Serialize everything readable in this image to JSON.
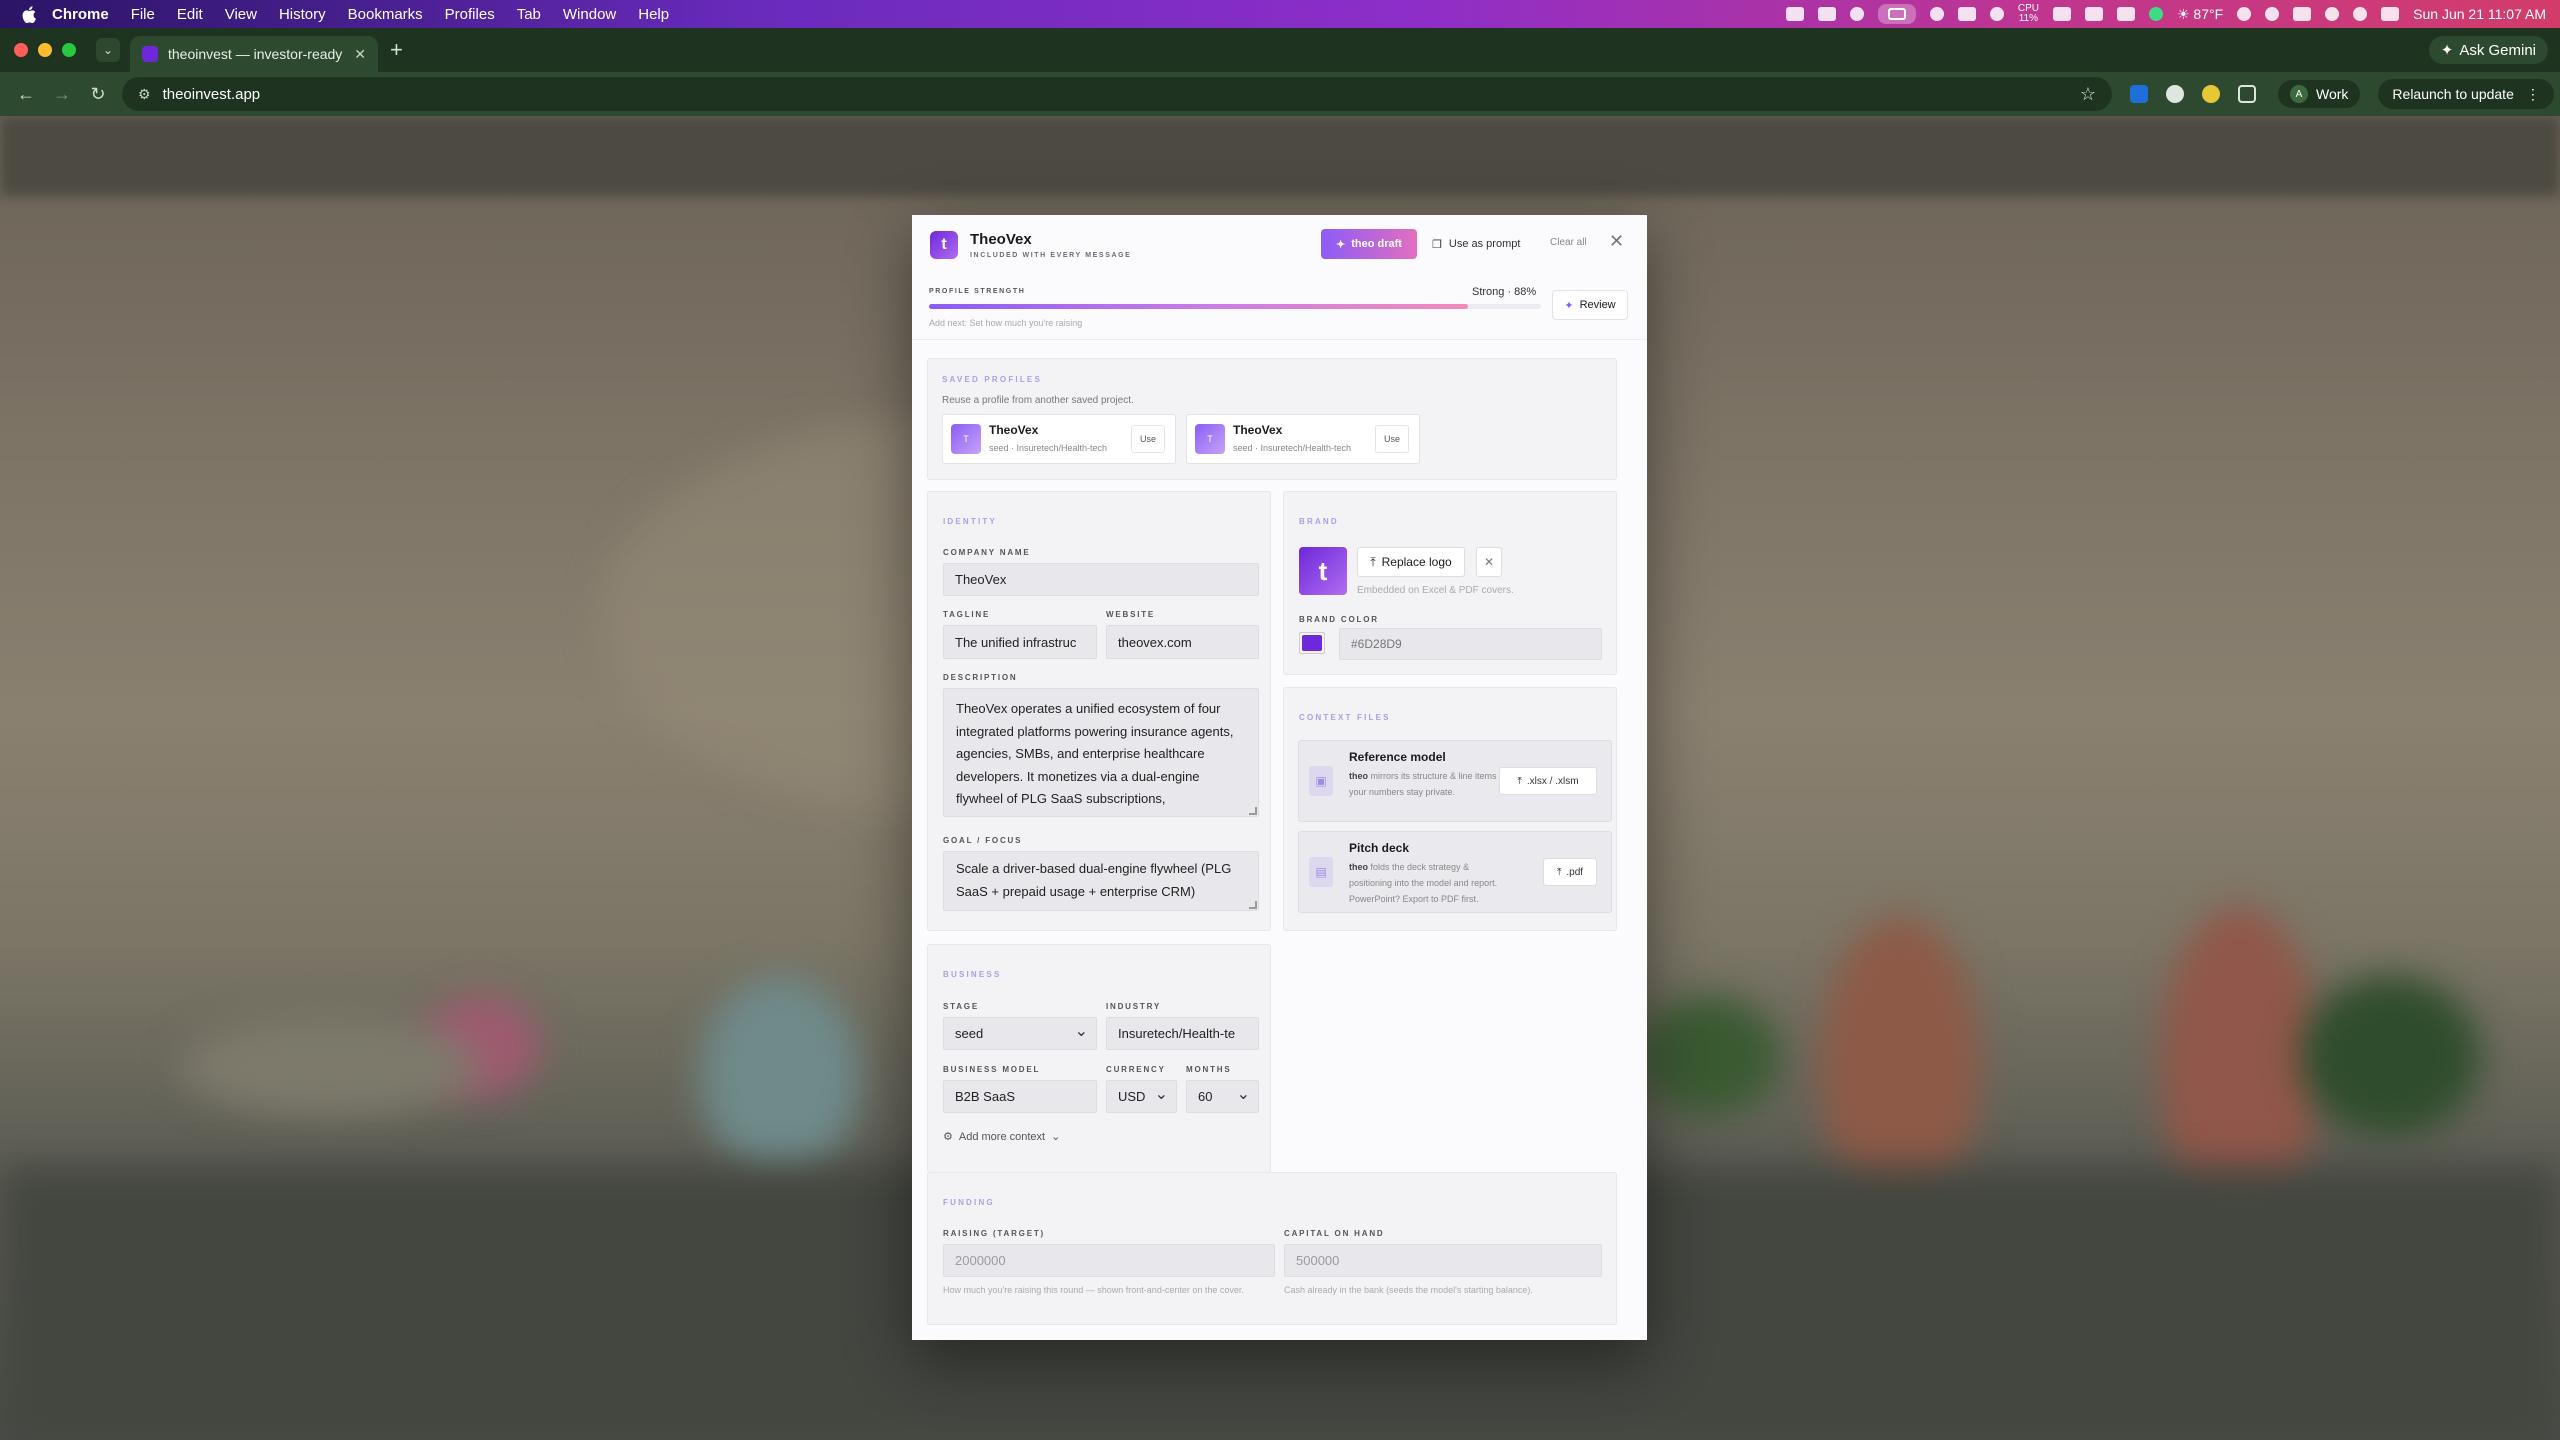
{
  "menubar": {
    "app": "Chrome",
    "items": [
      "File",
      "Edit",
      "View",
      "History",
      "Bookmarks",
      "Profiles",
      "Tab",
      "Window",
      "Help"
    ],
    "cpu_label": "CPU",
    "cpu_value": "11%",
    "weather": "☀ 87°F",
    "datetime": "Sun Jun 21  11:07 AM"
  },
  "browser": {
    "tab_title": "theoinvest — investor-ready f",
    "url": "theoinvest.app",
    "ask_gemini": "Ask Gemini",
    "profile": "Work",
    "profile_initial": "A",
    "relaunch": "Relaunch to update"
  },
  "modal": {
    "logo_letter": "t",
    "title": "TheoVex",
    "subtitle": "INCLUDED WITH EVERY MESSAGE",
    "draft_button": "theo draft",
    "prompt_button": "Use as prompt",
    "clear_button": "Clear all",
    "profile_strength": {
      "label": "PROFILE STRENGTH",
      "value_text": "Strong · 88%",
      "value": 0.88,
      "next": "Add next: Set how much you're raising",
      "review_button": "Review"
    },
    "saved_profiles": {
      "heading": "SAVED PROFILES",
      "description": "Reuse a profile from another saved project.",
      "items": [
        {
          "initial": "T",
          "name": "TheoVex",
          "detail": "seed · Insuretech/Health-tech",
          "action": "Use"
        },
        {
          "initial": "T",
          "name": "TheoVex",
          "detail": "seed · Insuretech/Health-tech",
          "action": "Use"
        }
      ]
    },
    "identity": {
      "heading": "IDENTITY",
      "company_label": "COMPANY NAME",
      "company": "TheoVex",
      "tagline_label": "TAGLINE",
      "tagline": "The unified infrastruc",
      "website_label": "WEBSITE",
      "website": "theovex.com",
      "description_label": "DESCRIPTION",
      "description": "TheoVex operates a unified ecosystem of four integrated platforms powering insurance agents, agencies, SMBs, and enterprise healthcare developers. It monetizes via a dual-engine flywheel of PLG SaaS subscriptions,",
      "goal_label": "GOAL / FOCUS",
      "goal": "Scale a driver-based dual-engine flywheel (PLG SaaS + prepaid usage + enterprise CRM)"
    },
    "brand": {
      "heading": "BRAND",
      "logo_letter": "t",
      "replace_button": "Replace logo",
      "embed_note": "Embedded on Excel & PDF covers.",
      "color_label": "BRAND COLOR",
      "color": "#6D28D9"
    },
    "context_files": {
      "heading": "CONTEXT FILES",
      "items": [
        {
          "title": "Reference model",
          "brand": "theo",
          "desc": "mirrors its structure & line items — your numbers stay private.",
          "button": ".xlsx / .xlsm"
        },
        {
          "title": "Pitch deck",
          "brand": "theo",
          "desc": "folds the deck strategy & positioning into the model and report. PowerPoint? Export to PDF first.",
          "button": ".pdf"
        }
      ]
    },
    "business": {
      "heading": "BUSINESS",
      "stage_label": "STAGE",
      "stage": "seed",
      "industry_label": "INDUSTRY",
      "industry": "Insuretech/Health-te",
      "model_label": "BUSINESS MODEL",
      "model": "B2B SaaS",
      "currency_label": "CURRENCY",
      "currency": "USD",
      "months_label": "MONTHS",
      "months": "60",
      "more_context": "Add more context"
    },
    "funding": {
      "heading": "FUNDING",
      "raising_label": "RAISING (TARGET)",
      "raising_placeholder": "2000000",
      "raising_hint": "How much you're raising this round — shown front-and-center on the cover.",
      "cash_label": "CAPITAL ON HAND",
      "cash_placeholder": "500000",
      "cash_hint": "Cash already in the bank (seeds the model's starting balance)."
    }
  }
}
